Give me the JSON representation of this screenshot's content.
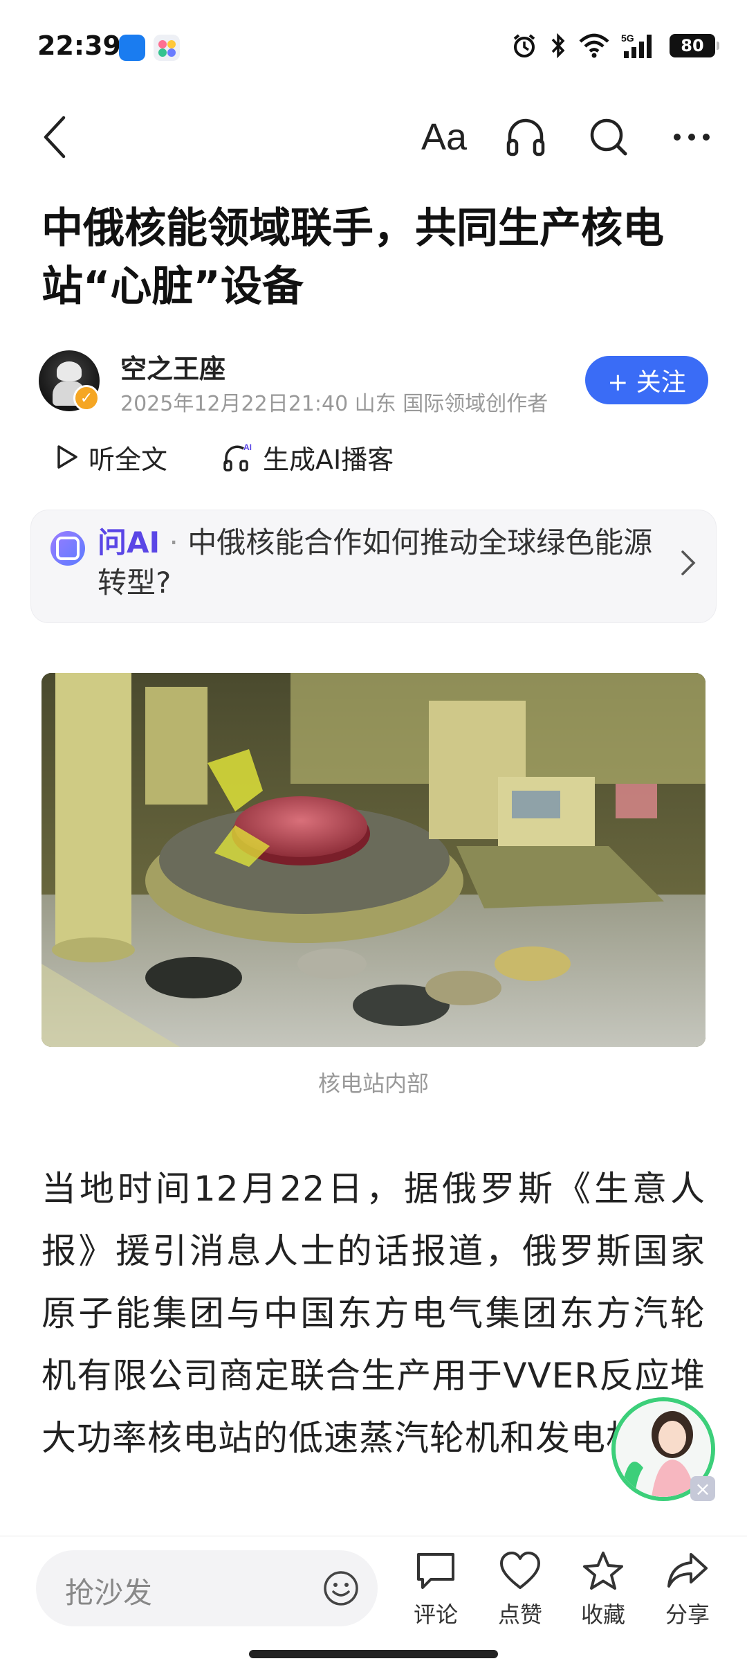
{
  "status_bar": {
    "time": "22:39",
    "battery": "80",
    "network": "5G"
  },
  "toolbar": {
    "font_label": "Aa",
    "icons": [
      "back-icon",
      "font-size-icon",
      "headphones-icon",
      "search-icon",
      "more-icon"
    ]
  },
  "article": {
    "title": "中俄核能领域联手，共同生产核电站“心脏”设备",
    "author": {
      "name": "空之王座",
      "meta": "2025年12月22日21:40 山东 国际领域创作者",
      "follow_label": "+ 关注"
    },
    "listen_label": "听全文",
    "podcast_label": "生成AI播客",
    "ask_ai": {
      "label": "问AI",
      "separator": " · ",
      "question": "中俄核能合作如何推动全球绿色能源转型?"
    },
    "photo_caption": "核电站内部",
    "body": "当地时间12月22日，据俄罗斯《生意人报》援引消息人士的话报道，俄罗斯国家原子能集团与中国东方电气集团东方汽轮机有限公司商定联合生产用于VVER反应堆大功率核电站的低速蒸汽轮机和发电机。"
  },
  "bottom_bar": {
    "comment_placeholder": "抢沙发",
    "actions": [
      {
        "label": "评论",
        "icon": "comment-icon"
      },
      {
        "label": "点赞",
        "icon": "heart-icon"
      },
      {
        "label": "收藏",
        "icon": "star-icon"
      },
      {
        "label": "分享",
        "icon": "share-icon"
      }
    ]
  },
  "colors": {
    "accent": "#3a6cf6",
    "ai_label": "#5a46e6",
    "assistant_ring": "#3ccf7a"
  }
}
